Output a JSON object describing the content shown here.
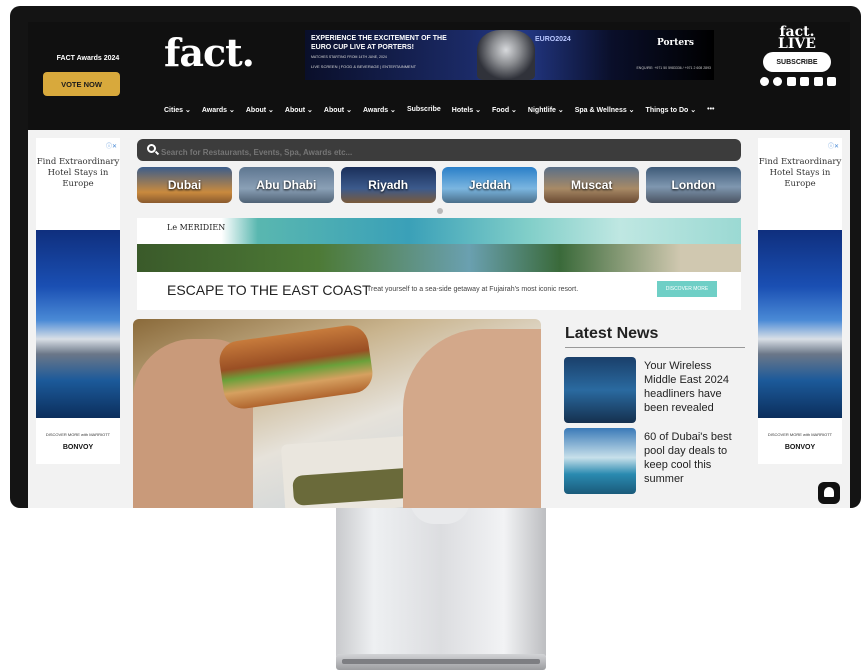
{
  "header": {
    "awards_title": "FACT Awards 2024",
    "vote_button": "VOTE NOW",
    "logo": "fact.",
    "live_logo_line1": "fact.",
    "live_logo_line2": "LIVE",
    "subscribe_button": "SUBSCRIBE",
    "socials": [
      "facebook-icon",
      "instagram-icon",
      "tiktok-icon",
      "threads-icon",
      "youtube-icon",
      "linkedin-icon"
    ]
  },
  "banner": {
    "headline": "EXPERIENCE THE EXCITEMENT OF THE EURO CUP LIVE AT PORTERS!",
    "dates": "MATCHES STARTING FROM 14TH JUNE, 2024",
    "features": "LIVE SCREEN | FOOD & BEVERAGE | ENTERTAINMENT",
    "event": "EURO2024",
    "venue": "Porters",
    "enquire": "ENQUIRE: +971 50 5983336 / +971 2 608 2893"
  },
  "nav": [
    "Cities ⌄",
    "Awards ⌄",
    "About ⌄",
    "About ⌄",
    "About ⌄",
    "Awards ⌄",
    "Subscribe",
    "Hotels ⌄",
    "Food ⌄",
    "Nightlife ⌄",
    "Spa & Wellness ⌄",
    "Things to Do ⌄",
    "•••"
  ],
  "search": {
    "placeholder": "Search for Restaurants, Events, Spa, Awards etc..."
  },
  "cities": [
    "Dubai",
    "Abu Dhabi",
    "Riyadh",
    "Jeddah",
    "Muscat",
    "London"
  ],
  "side_ad": {
    "text": "Find Extraordinary Hotel Stays in Europe",
    "discover": "DISCOVER MORE with MARRIOTT",
    "brand": "BONVOY"
  },
  "promo": {
    "brand": "Le MERIDIEN",
    "headline": "ESCAPE TO THE EAST COAST",
    "sub": "Treat yourself to a sea-side getaway at Fujairah's most iconic resort.",
    "button": "DISCOVER MORE"
  },
  "news": {
    "title": "Latest News",
    "items": [
      {
        "text": "Your Wireless Middle East 2024 headliners have been revealed"
      },
      {
        "text": "60 of Dubai's best pool day deals to keep cool this summer"
      }
    ]
  }
}
